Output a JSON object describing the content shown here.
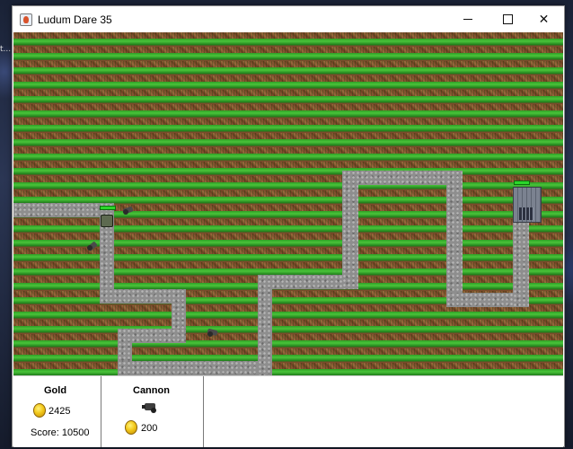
{
  "desktop": {
    "edge_text": "t..."
  },
  "window": {
    "title": "Ludum Dare 35",
    "icon": "java-app-icon"
  },
  "window_controls": {
    "minimize": "minimize-icon",
    "maximize": "maximize-icon",
    "close": "close-icon",
    "close_glyph": "✕"
  },
  "hud": {
    "gold": {
      "label": "Gold",
      "amount": "2425",
      "score_text": "Score: 10500"
    },
    "cannon_shop": {
      "label": "Cannon",
      "cost": "200",
      "icon": "cannon-icon"
    }
  },
  "colors": {
    "path": "#8e8e8e",
    "grass": "#3fb532",
    "dirt": "#7a4b2c",
    "health": "#2bd62b",
    "coin": "#f2c81a"
  }
}
